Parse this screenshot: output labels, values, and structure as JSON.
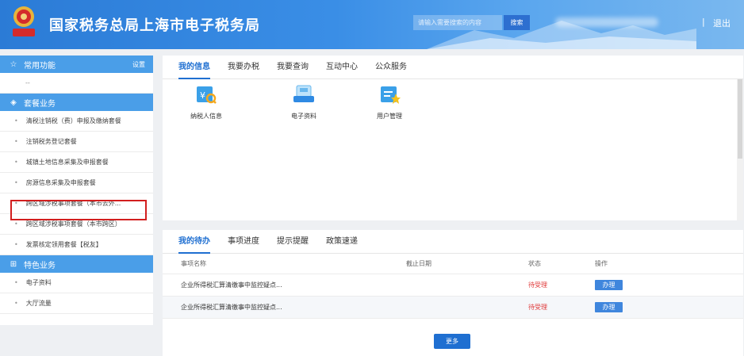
{
  "header": {
    "title": "国家税务总局上海市电子税务局",
    "search_placeholder": "请输入需要搜索的内容",
    "search_button": "搜索",
    "separator": "|",
    "logout": "退出",
    "brand_color": "#2b7bd6"
  },
  "sidebar": {
    "common_title": "常用功能",
    "common_settings": "设置",
    "common_empty": "--",
    "package_title": "套餐业务",
    "package_items": [
      "清税注销税（费）申报及缴纳套餐",
      "注销税务登记套餐",
      "城镇土地信息采集及申报套餐",
      "房源信息采集及申报套餐",
      "跨区域涉税事项套餐（本市去外...",
      "跨区域涉税事项套餐（本市跨区）",
      "发票核定领用套餐【税友】"
    ],
    "special_title": "特色业务",
    "special_items": [
      "电子资料",
      "大厅流量"
    ]
  },
  "info_panel": {
    "tabs": [
      "我的信息",
      "我要办税",
      "我要查询",
      "互动中心",
      "公众服务"
    ],
    "services": [
      "纳税人信息",
      "电子资料",
      "用户管理"
    ]
  },
  "todo_panel": {
    "tabs": [
      "我的待办",
      "事项进度",
      "提示提醒",
      "政策速递"
    ],
    "columns": [
      "事项名称",
      "截止日期",
      "状态",
      "操作"
    ],
    "rows": [
      {
        "name": "企业所得税汇算清缴事中监控疑点...",
        "date": "",
        "status": "待受理",
        "action": "办理"
      },
      {
        "name": "企业所得税汇算清缴事中监控疑点...",
        "date": "",
        "status": "待受理",
        "action": "办理"
      }
    ],
    "more": "更多"
  }
}
